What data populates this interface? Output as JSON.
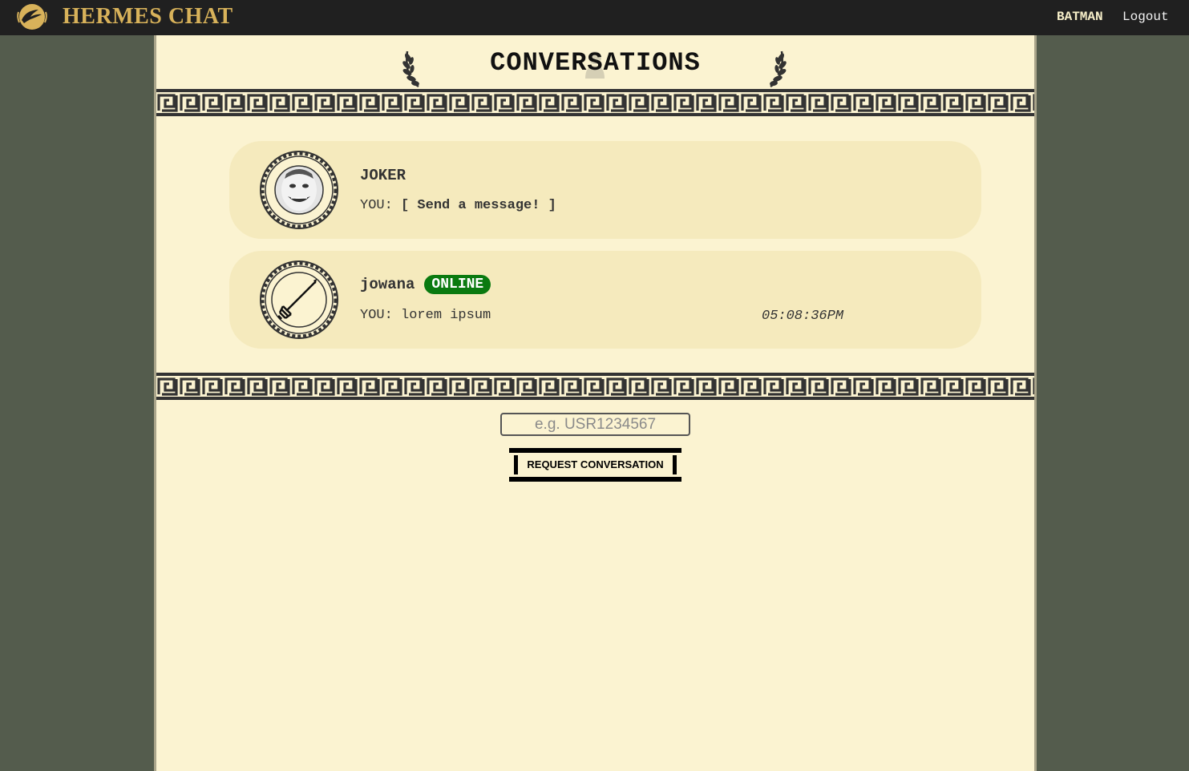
{
  "header": {
    "app_title": "HERMES CHAT",
    "username": "BATMAN",
    "logout_label": "Logout",
    "logo_icon": "hermes-winged-logo-icon",
    "brand_color": "#d8b25a",
    "bar_color": "#202020"
  },
  "page": {
    "title": "CONVERSATIONS",
    "background_color": "#545c4d",
    "panel_color": "#fbf3d1"
  },
  "conversations": [
    {
      "name": "JOKER",
      "online": false,
      "preview_prefix": "YOU:",
      "preview_text": "[ Send a message! ]",
      "time": "",
      "avatar_icon": "joker-face-avatar-icon"
    },
    {
      "name": "jowana",
      "online": true,
      "online_label": "ONLINE",
      "preview_prefix": "YOU:",
      "preview_text": "lorem ipsum",
      "time": "05:08:36PM",
      "avatar_icon": "trident-avatar-icon"
    }
  ],
  "request_form": {
    "input_placeholder": "e.g. USR1234567",
    "input_value": "",
    "button_label": "REQUEST CONVERSATION"
  },
  "colors": {
    "card": "#f5eabd",
    "online_badge": "#0a7a10"
  }
}
